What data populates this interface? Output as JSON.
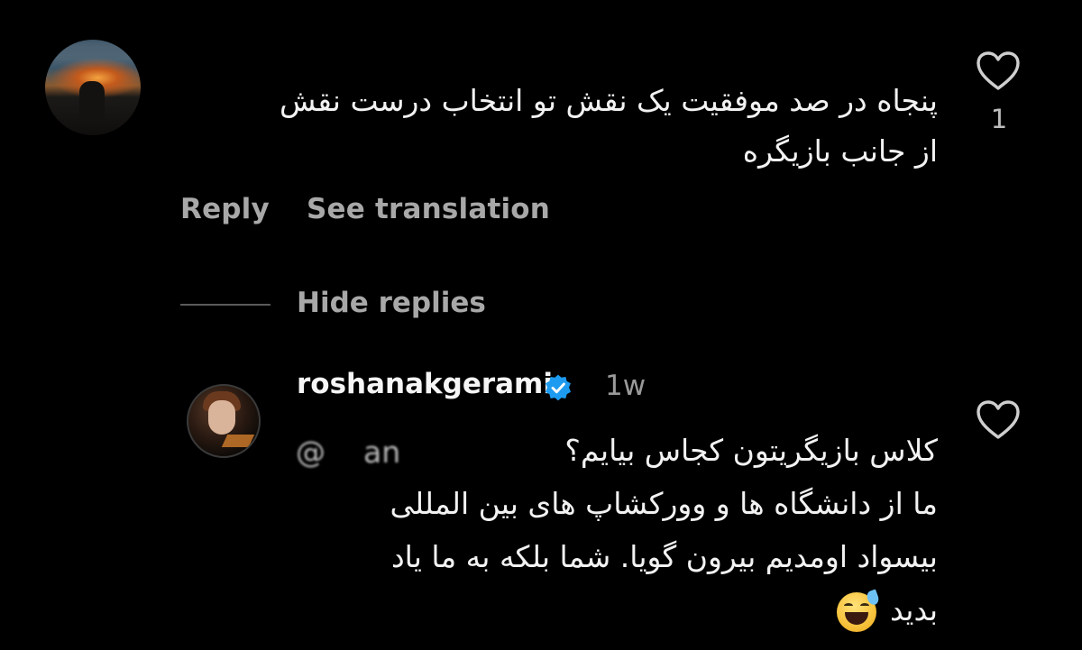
{
  "comment": {
    "text_line1": "پنجاه در صد موفقیت یک نقش تو انتخاب درست نقش",
    "text_line2": "از جانب بازیگره",
    "like_count": "1",
    "reply_label": "Reply",
    "translate_label": "See translation"
  },
  "replies": {
    "hide_label": "Hide replies"
  },
  "reply": {
    "username": "roshanakgerami",
    "time": "1w",
    "mention_partial": "@",
    "mention_visible": "an",
    "line1": "کلاس بازیگریتون کجاس بیایم؟",
    "line2": "ما از دانشگاه ها و وورکشاپ های بین المللی",
    "line3": "بیسواد اومدیم بیرون گویا. شما بلکه به ما یاد",
    "line4": "بدید",
    "emoji": "grinning-face-with-sweat"
  },
  "colors": {
    "background": "#000000",
    "text_primary": "#f2f2f2",
    "text_secondary": "#a8a8a8",
    "verified_badge": "#1d9bf0"
  }
}
